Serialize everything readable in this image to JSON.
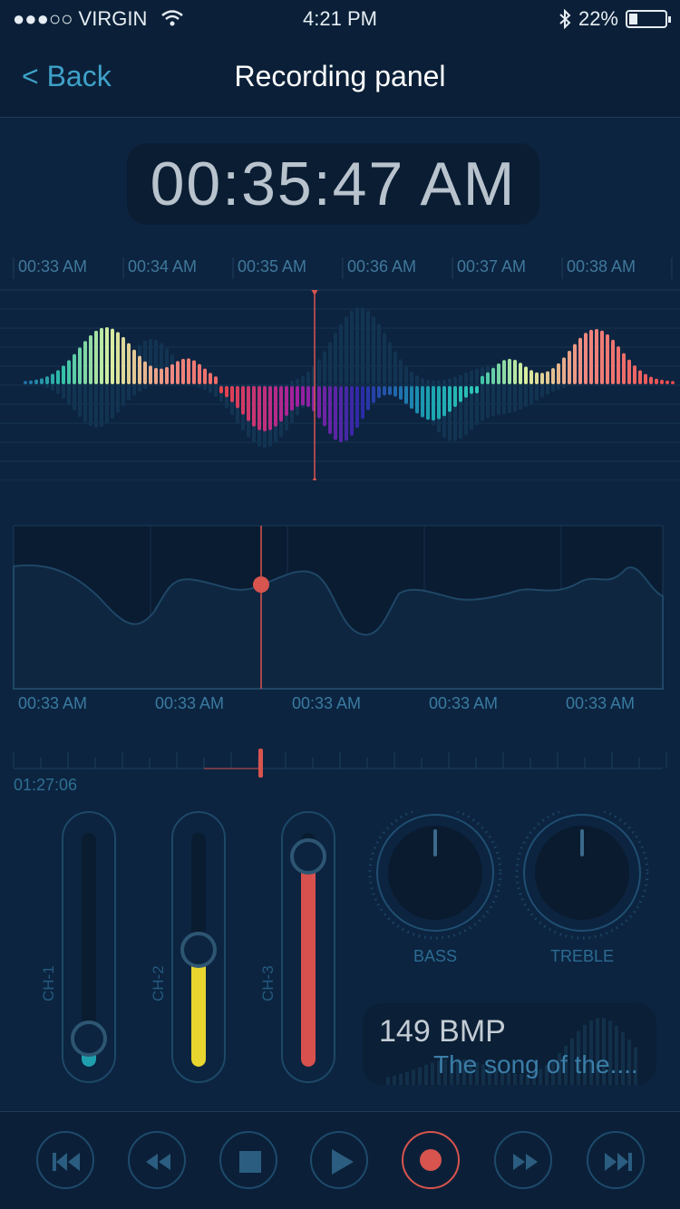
{
  "status_bar": {
    "carrier": "●●●○○ VIRGIN",
    "time": "4:21 PM",
    "battery": "22%",
    "battery_level": 0.22
  },
  "nav": {
    "back_label": "< Back",
    "title": "Recording panel"
  },
  "clock": "00:35:47 AM",
  "timeline_top": [
    "00:33 AM",
    "00:34 AM",
    "00:35 AM",
    "00:36 AM",
    "00:37 AM",
    "00:38 AM"
  ],
  "timeline_bottom": [
    "00:33 AM",
    "00:33 AM",
    "00:33 AM",
    "00:33 AM",
    "00:33 AM"
  ],
  "position_time": "01:27:06",
  "channels": [
    {
      "label": "CH-1",
      "level": 0.12,
      "color": "#1f9fae"
    },
    {
      "label": "CH-2",
      "level": 0.5,
      "color": "#e8d52f"
    },
    {
      "label": "CH-3",
      "level": 0.9,
      "color": "#d9514e"
    }
  ],
  "knobs": [
    {
      "label": "BASS",
      "value": 0.5
    },
    {
      "label": "TREBLE",
      "value": 0.5
    }
  ],
  "song_card": {
    "bpm": "149 BMP",
    "song": "The song of the...."
  },
  "controls": [
    "skip-back",
    "rewind",
    "stop",
    "play",
    "record",
    "fast-forward",
    "skip-forward"
  ],
  "colors": {
    "accent": "#3fa1c9",
    "record": "#d8544e",
    "background": "#0c2440"
  }
}
